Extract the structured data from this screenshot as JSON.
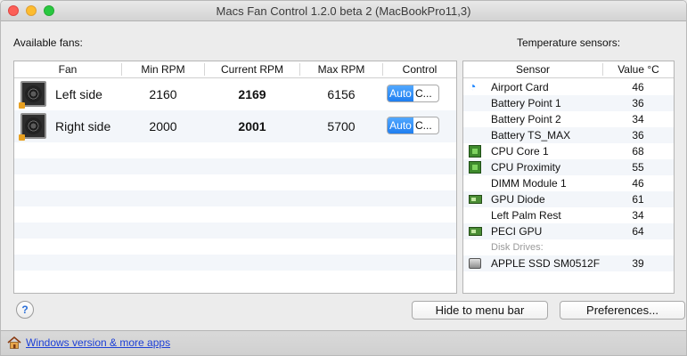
{
  "window": {
    "title": "Macs Fan Control 1.2.0 beta 2 (MacBookPro11,3)"
  },
  "fans_panel": {
    "label": "Available fans:",
    "columns": [
      "Fan",
      "Min RPM",
      "Current RPM",
      "Max RPM",
      "Control"
    ],
    "rows": [
      {
        "name": "Left side",
        "min_rpm": "2160",
        "current_rpm": "2169",
        "max_rpm": "6156",
        "control_auto": "Auto",
        "control_custom": "C..."
      },
      {
        "name": "Right side",
        "min_rpm": "2000",
        "current_rpm": "2001",
        "max_rpm": "5700",
        "control_auto": "Auto",
        "control_custom": "C..."
      }
    ]
  },
  "sensors_panel": {
    "label": "Temperature sensors:",
    "columns": [
      "Sensor",
      "Value °C"
    ],
    "rows": [
      {
        "name": "Airport Card",
        "value": "46",
        "icon": "wifi-icon"
      },
      {
        "name": "Battery Point 1",
        "value": "36",
        "icon": ""
      },
      {
        "name": "Battery Point 2",
        "value": "34",
        "icon": ""
      },
      {
        "name": "Battery TS_MAX",
        "value": "36",
        "icon": ""
      },
      {
        "name": "CPU Core 1",
        "value": "68",
        "icon": "cpu-chip-icon"
      },
      {
        "name": "CPU Proximity",
        "value": "55",
        "icon": "cpu-chip-icon"
      },
      {
        "name": "DIMM Module 1",
        "value": "46",
        "icon": ""
      },
      {
        "name": "GPU Diode",
        "value": "61",
        "icon": "gpu-card-icon"
      },
      {
        "name": "Left Palm Rest",
        "value": "34",
        "icon": ""
      },
      {
        "name": "PECI GPU",
        "value": "64",
        "icon": "gpu-card-icon"
      }
    ],
    "group_label": "Disk Drives:",
    "disk_rows": [
      {
        "name": "APPLE SSD SM0512F",
        "value": "39",
        "icon": "hard-drive-icon"
      }
    ]
  },
  "buttons": {
    "help": "?",
    "hide": "Hide to menu bar",
    "preferences": "Preferences..."
  },
  "footer": {
    "link": "Windows version & more apps"
  },
  "colors": {
    "accent": "#1f7ef0",
    "link": "#1c3fd6",
    "row_alt": "#f3f6fa"
  }
}
